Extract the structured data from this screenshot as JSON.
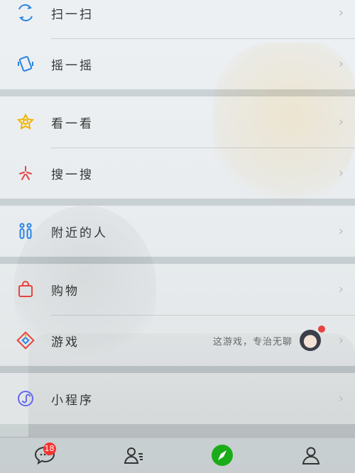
{
  "menu": {
    "items": [
      {
        "label": "扫一扫",
        "icon": "scan-icon",
        "color": "#2a82e4"
      },
      {
        "label": "摇一摇",
        "icon": "shake-icon",
        "color": "#2a82e4"
      },
      {
        "label": "看一看",
        "icon": "top-stories-icon",
        "color": "#f0b400"
      },
      {
        "label": "搜一搜",
        "icon": "search-star-icon",
        "color": "#e64340"
      },
      {
        "label": "附近的人",
        "icon": "people-nearby-icon",
        "color": "#2a82e4"
      },
      {
        "label": "购物",
        "icon": "shopping-bag-icon",
        "color": "#e64340"
      },
      {
        "label": "游戏",
        "icon": "games-icon",
        "color": "#e64340"
      },
      {
        "label": "小程序",
        "icon": "mini-programs-icon",
        "color": "#6467f0"
      }
    ],
    "games_extra_text": "这游戏，专治无聊"
  },
  "tabbar": {
    "chats_badge": "18",
    "active_color": "#1aad19"
  }
}
